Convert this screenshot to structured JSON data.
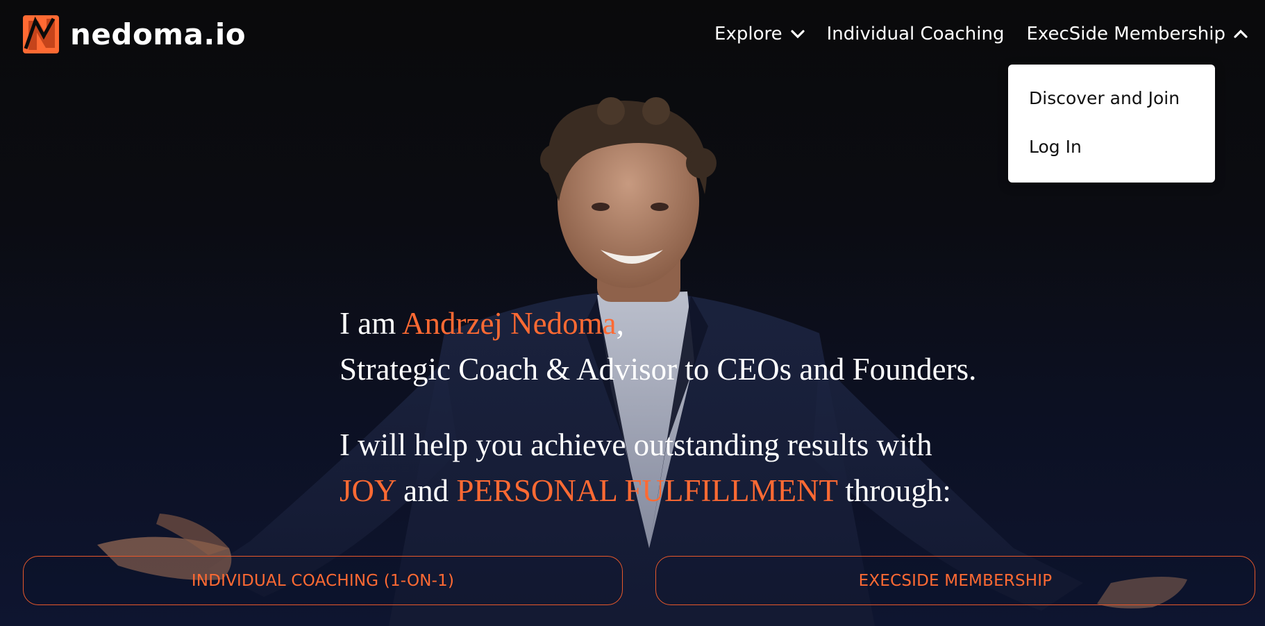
{
  "brand": {
    "name": "nedoma.io",
    "accent": "#ff6a33"
  },
  "nav": {
    "items": [
      {
        "label": "Explore",
        "icon": "chevron-down-icon"
      },
      {
        "label": "Individual Coaching"
      },
      {
        "label": "ExecSide Membership",
        "icon": "chevron-up-icon"
      }
    ]
  },
  "dropdown": {
    "items": [
      {
        "label": "Discover and Join"
      },
      {
        "label": "Log In"
      }
    ]
  },
  "hero": {
    "line1_prefix": "I am ",
    "line1_name": "Andrzej Nedoma",
    "line1_suffix": ",",
    "line2": "Strategic Coach & Advisor to CEOs and Founders.",
    "line3": "I will help you achieve outstanding results with",
    "line4_joy": "JOY",
    "line4_and": " and ",
    "line4_fulfillment": "PERSONAL FULFILLMENT",
    "line4_suffix": " through:"
  },
  "cta": {
    "left": "INDIVIDUAL COACHING (1-ON-1)",
    "right": "EXECSIDE MEMBERSHIP"
  }
}
